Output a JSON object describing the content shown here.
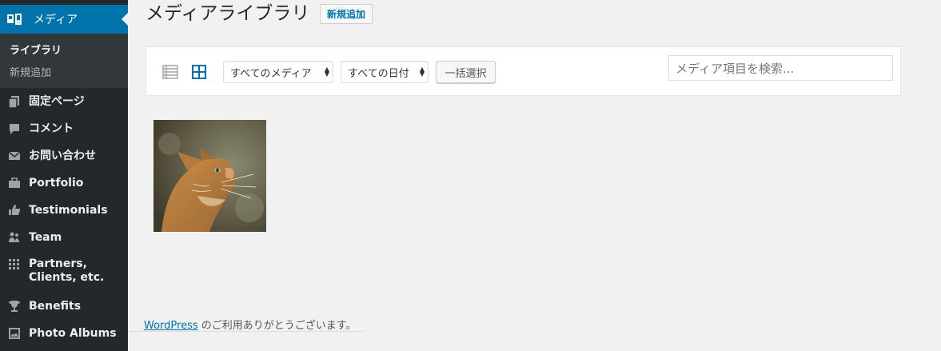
{
  "sidebar": {
    "current": {
      "label": "メディア",
      "icon": "media-icon"
    },
    "submenu": [
      {
        "label": "ライブラリ",
        "active": true
      },
      {
        "label": "新規追加",
        "active": false
      }
    ],
    "items": [
      {
        "label": "固定ページ",
        "icon": "pages-icon"
      },
      {
        "label": "コメント",
        "icon": "comments-icon"
      },
      {
        "label": "お問い合わせ",
        "icon": "mail-icon"
      },
      {
        "label": "Portfolio",
        "icon": "briefcase-icon"
      },
      {
        "label": "Testimonials",
        "icon": "thumbs-up-icon"
      },
      {
        "label": "Team",
        "icon": "team-icon"
      },
      {
        "label": "Partners, Clients, etc.",
        "icon": "grid-icon"
      },
      {
        "label": "Benefits",
        "icon": "trophy-icon"
      },
      {
        "label": "Photo Albums",
        "icon": "photo-album-icon"
      }
    ],
    "accent": "#0073aa"
  },
  "header": {
    "title": "メディアライブラリ",
    "add_new": "新規追加"
  },
  "toolbar": {
    "type_filter": "すべてのメディア",
    "date_filter": "すべての日付",
    "bulk_select": "一括選択",
    "search_placeholder": "メディア項目を検索..."
  },
  "media": [
    {
      "kind": "image",
      "subject": "orange tabby cat looking up"
    }
  ],
  "footer": {
    "link": "WordPress",
    "text": " のご利用ありがとうございます。"
  }
}
